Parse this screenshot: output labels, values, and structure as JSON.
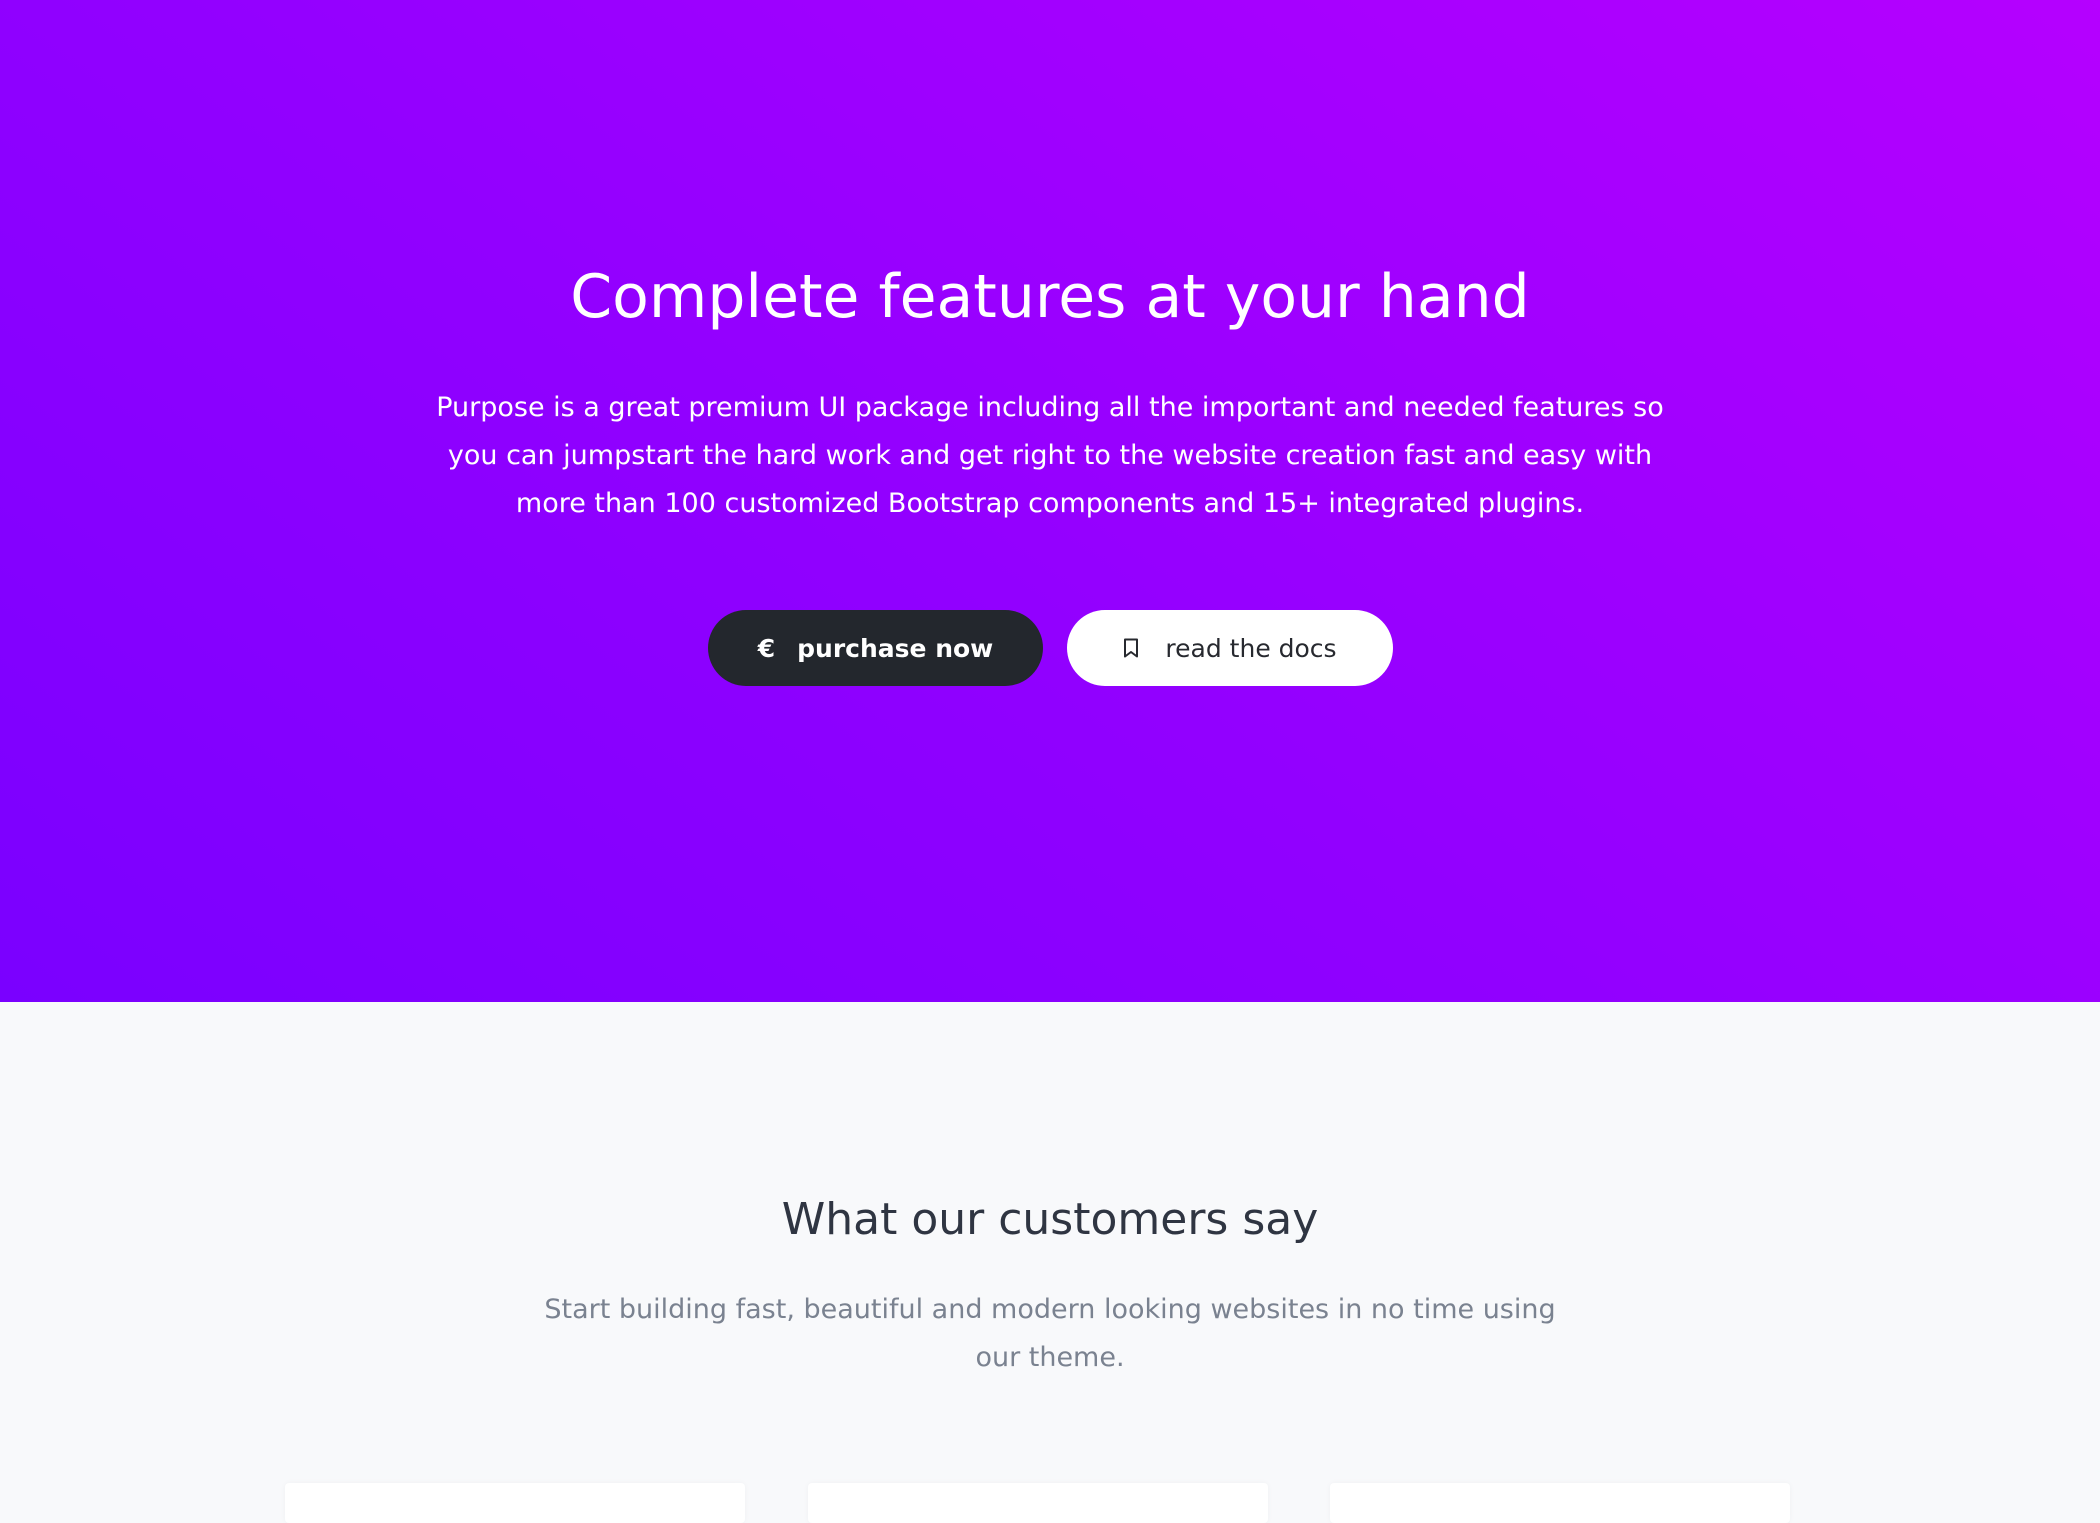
{
  "hero": {
    "title": "Complete features at your hand",
    "description": "Purpose is a great premium UI package including all the important and needed features so you can jumpstart the hard work and get right to the website creation fast and easy with more than 100 customized Bootstrap components and 15+ integrated plugins.",
    "gradient_colors": [
      "#7a00ff",
      "#b500ff"
    ],
    "buttons": {
      "purchase": {
        "label": "purchase now",
        "icon": "euro-icon"
      },
      "docs": {
        "label": "read the docs",
        "icon": "bookmark-icon"
      }
    }
  },
  "testimonials": {
    "title": "What our customers say",
    "description": "Start building fast, beautiful and modern looking websites in no time using our theme.",
    "cards": [
      {},
      {},
      {}
    ]
  },
  "colors": {
    "dark_button": "#23272d",
    "light_button": "#ffffff",
    "section_background": "#f8f9fb"
  }
}
